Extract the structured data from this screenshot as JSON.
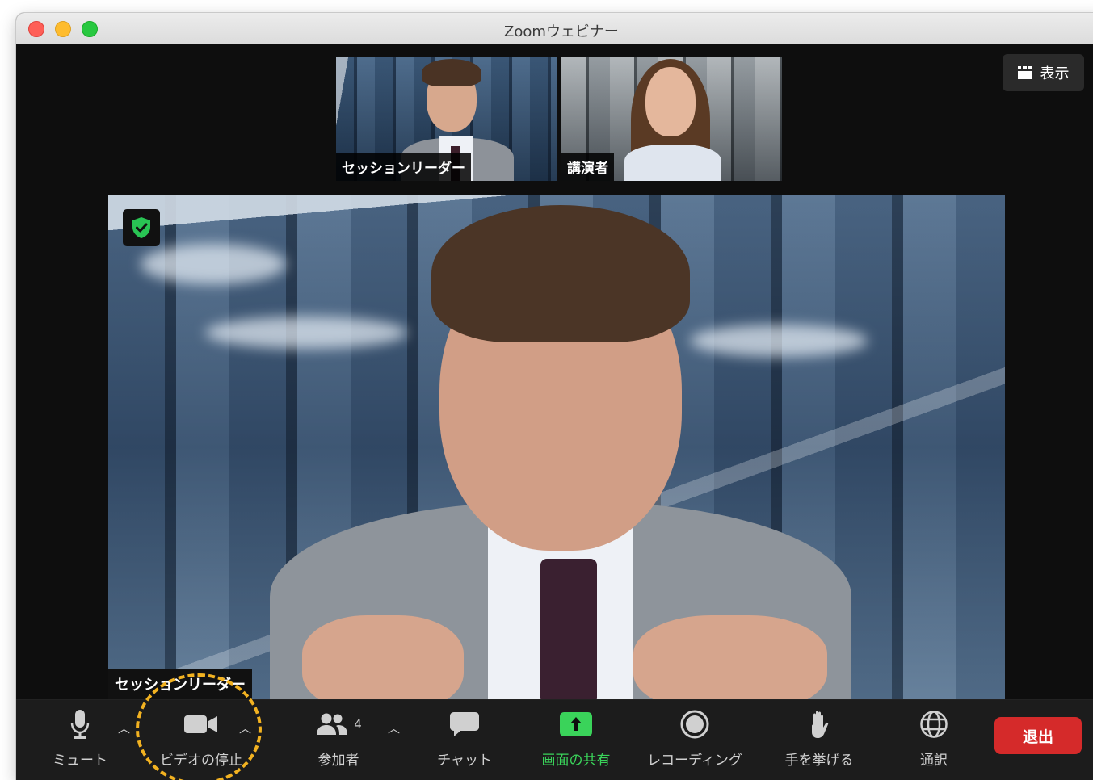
{
  "window": {
    "title": "Zoomウェビナー"
  },
  "view_button": {
    "label": "表示",
    "icon": "gallery-grid-icon"
  },
  "thumbnails": [
    {
      "name": "セッションリーダー"
    },
    {
      "name": "講演者"
    }
  ],
  "main_video": {
    "name": "セッションリーダー",
    "encryption_icon": "shield-check-icon",
    "encryption_color": "#29c454"
  },
  "toolbar": {
    "mute": {
      "label": "ミュート",
      "icon": "microphone-icon"
    },
    "video": {
      "label": "ビデオの停止",
      "icon": "video-camera-icon"
    },
    "participants": {
      "label": "参加者",
      "count": "4",
      "icon": "participants-icon"
    },
    "chat": {
      "label": "チャット",
      "icon": "chat-bubble-icon"
    },
    "share": {
      "label": "画面の共有",
      "icon": "share-screen-icon",
      "color": "#3ad35a"
    },
    "record": {
      "label": "レコーディング",
      "icon": "record-icon"
    },
    "raise_hand": {
      "label": "手を挙げる",
      "icon": "raise-hand-icon"
    },
    "interpretation": {
      "label": "通訳",
      "icon": "globe-icon"
    },
    "leave": {
      "label": "退出",
      "color": "#d52a2a"
    }
  },
  "annotation": {
    "color": "#f2b221",
    "target": "video"
  }
}
